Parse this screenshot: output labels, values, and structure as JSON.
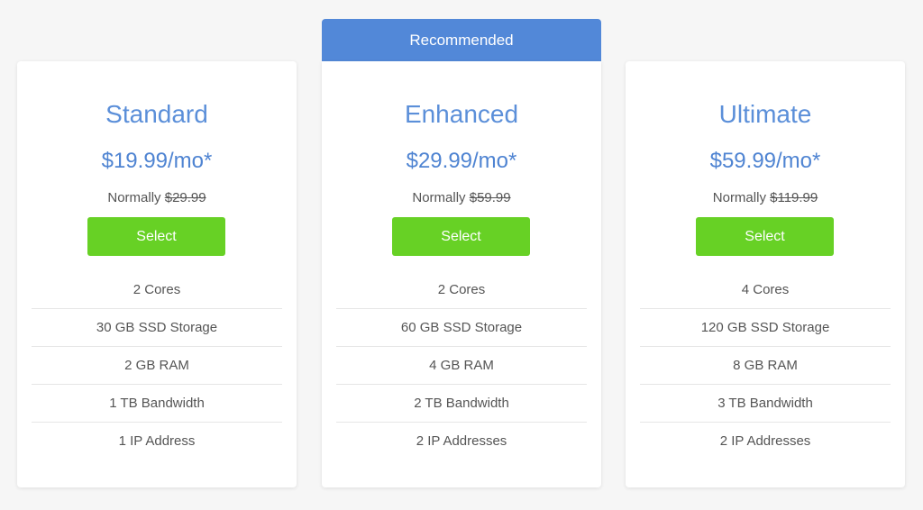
{
  "ribbon": {
    "label": "Recommended"
  },
  "plans": [
    {
      "name": "Standard",
      "price": "$19.99/mo*",
      "normally_label": "Normally",
      "normal_price": "$29.99",
      "select_label": "Select",
      "features": [
        "2 Cores",
        "30 GB SSD Storage",
        "2 GB RAM",
        "1 TB Bandwidth",
        "1 IP Address"
      ]
    },
    {
      "name": "Enhanced",
      "price": "$29.99/mo*",
      "normally_label": "Normally",
      "normal_price": "$59.99",
      "select_label": "Select",
      "features": [
        "2 Cores",
        "60 GB SSD Storage",
        "4 GB RAM",
        "2 TB Bandwidth",
        "2 IP Addresses"
      ]
    },
    {
      "name": "Ultimate",
      "price": "$59.99/mo*",
      "normally_label": "Normally",
      "normal_price": "$119.99",
      "select_label": "Select",
      "features": [
        "4 Cores",
        "120 GB SSD Storage",
        "8 GB RAM",
        "3 TB Bandwidth",
        "2 IP Addresses"
      ]
    }
  ],
  "colors": {
    "ribbon": "#5288d8",
    "plan_name": "#5b8fd9",
    "price": "#4f84d2",
    "select_button": "#67d125",
    "background": "#f6f6f6"
  }
}
